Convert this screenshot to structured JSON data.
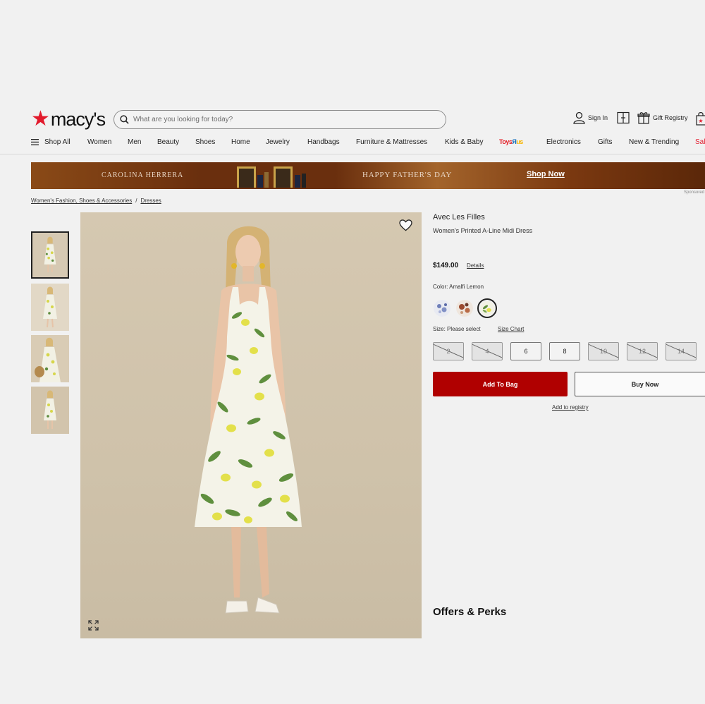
{
  "header": {
    "logo_text": "macy's",
    "search_placeholder": "What are you looking for today?",
    "sign_in": "Sign In",
    "gift_registry": "Gift Registry"
  },
  "nav": {
    "shop_all": "Shop All",
    "items": [
      "Women",
      "Men",
      "Beauty",
      "Shoes",
      "Home",
      "Jewelry",
      "Handbags",
      "Furniture & Mattresses",
      "Kids & Baby"
    ],
    "toys_r_us": "Toys R Us",
    "items_after": [
      "Electronics",
      "Gifts",
      "New & Trending"
    ],
    "sale": "Sale"
  },
  "banner": {
    "brand": "CAROLINA HERRERA",
    "headline": "HAPPY FATHER'S DAY",
    "cta": "Shop Now",
    "sponsored": "Sponsored"
  },
  "breadcrumb": [
    "Women's Fashion, Shoes & Accessories",
    "Dresses"
  ],
  "product": {
    "brand": "Avec Les Filles",
    "title": "Women's Printed A-Line Midi Dress",
    "price": "$149.00",
    "price_details": "Details",
    "color_label": "Color: Amalfi Lemon",
    "swatches": [
      "blue-floral",
      "rust-floral",
      "amalfi-lemon"
    ],
    "selected_swatch": "amalfi-lemon",
    "size_label": "Size: Please select",
    "size_chart": "Size Chart",
    "sizes": [
      {
        "label": "2",
        "available": false
      },
      {
        "label": "4",
        "available": false
      },
      {
        "label": "6",
        "available": true
      },
      {
        "label": "8",
        "available": true
      },
      {
        "label": "10",
        "available": false
      },
      {
        "label": "12",
        "available": false
      },
      {
        "label": "14",
        "available": false
      }
    ],
    "add_to_bag": "Add To Bag",
    "buy_now": "Buy Now",
    "add_to_registry": "Add to registry",
    "offers_heading": "Offers & Perks"
  },
  "colors": {
    "brand_red": "#e21a2c",
    "add_to_bag_bg": "#b00000",
    "image_bg": "#d2c5ae"
  }
}
